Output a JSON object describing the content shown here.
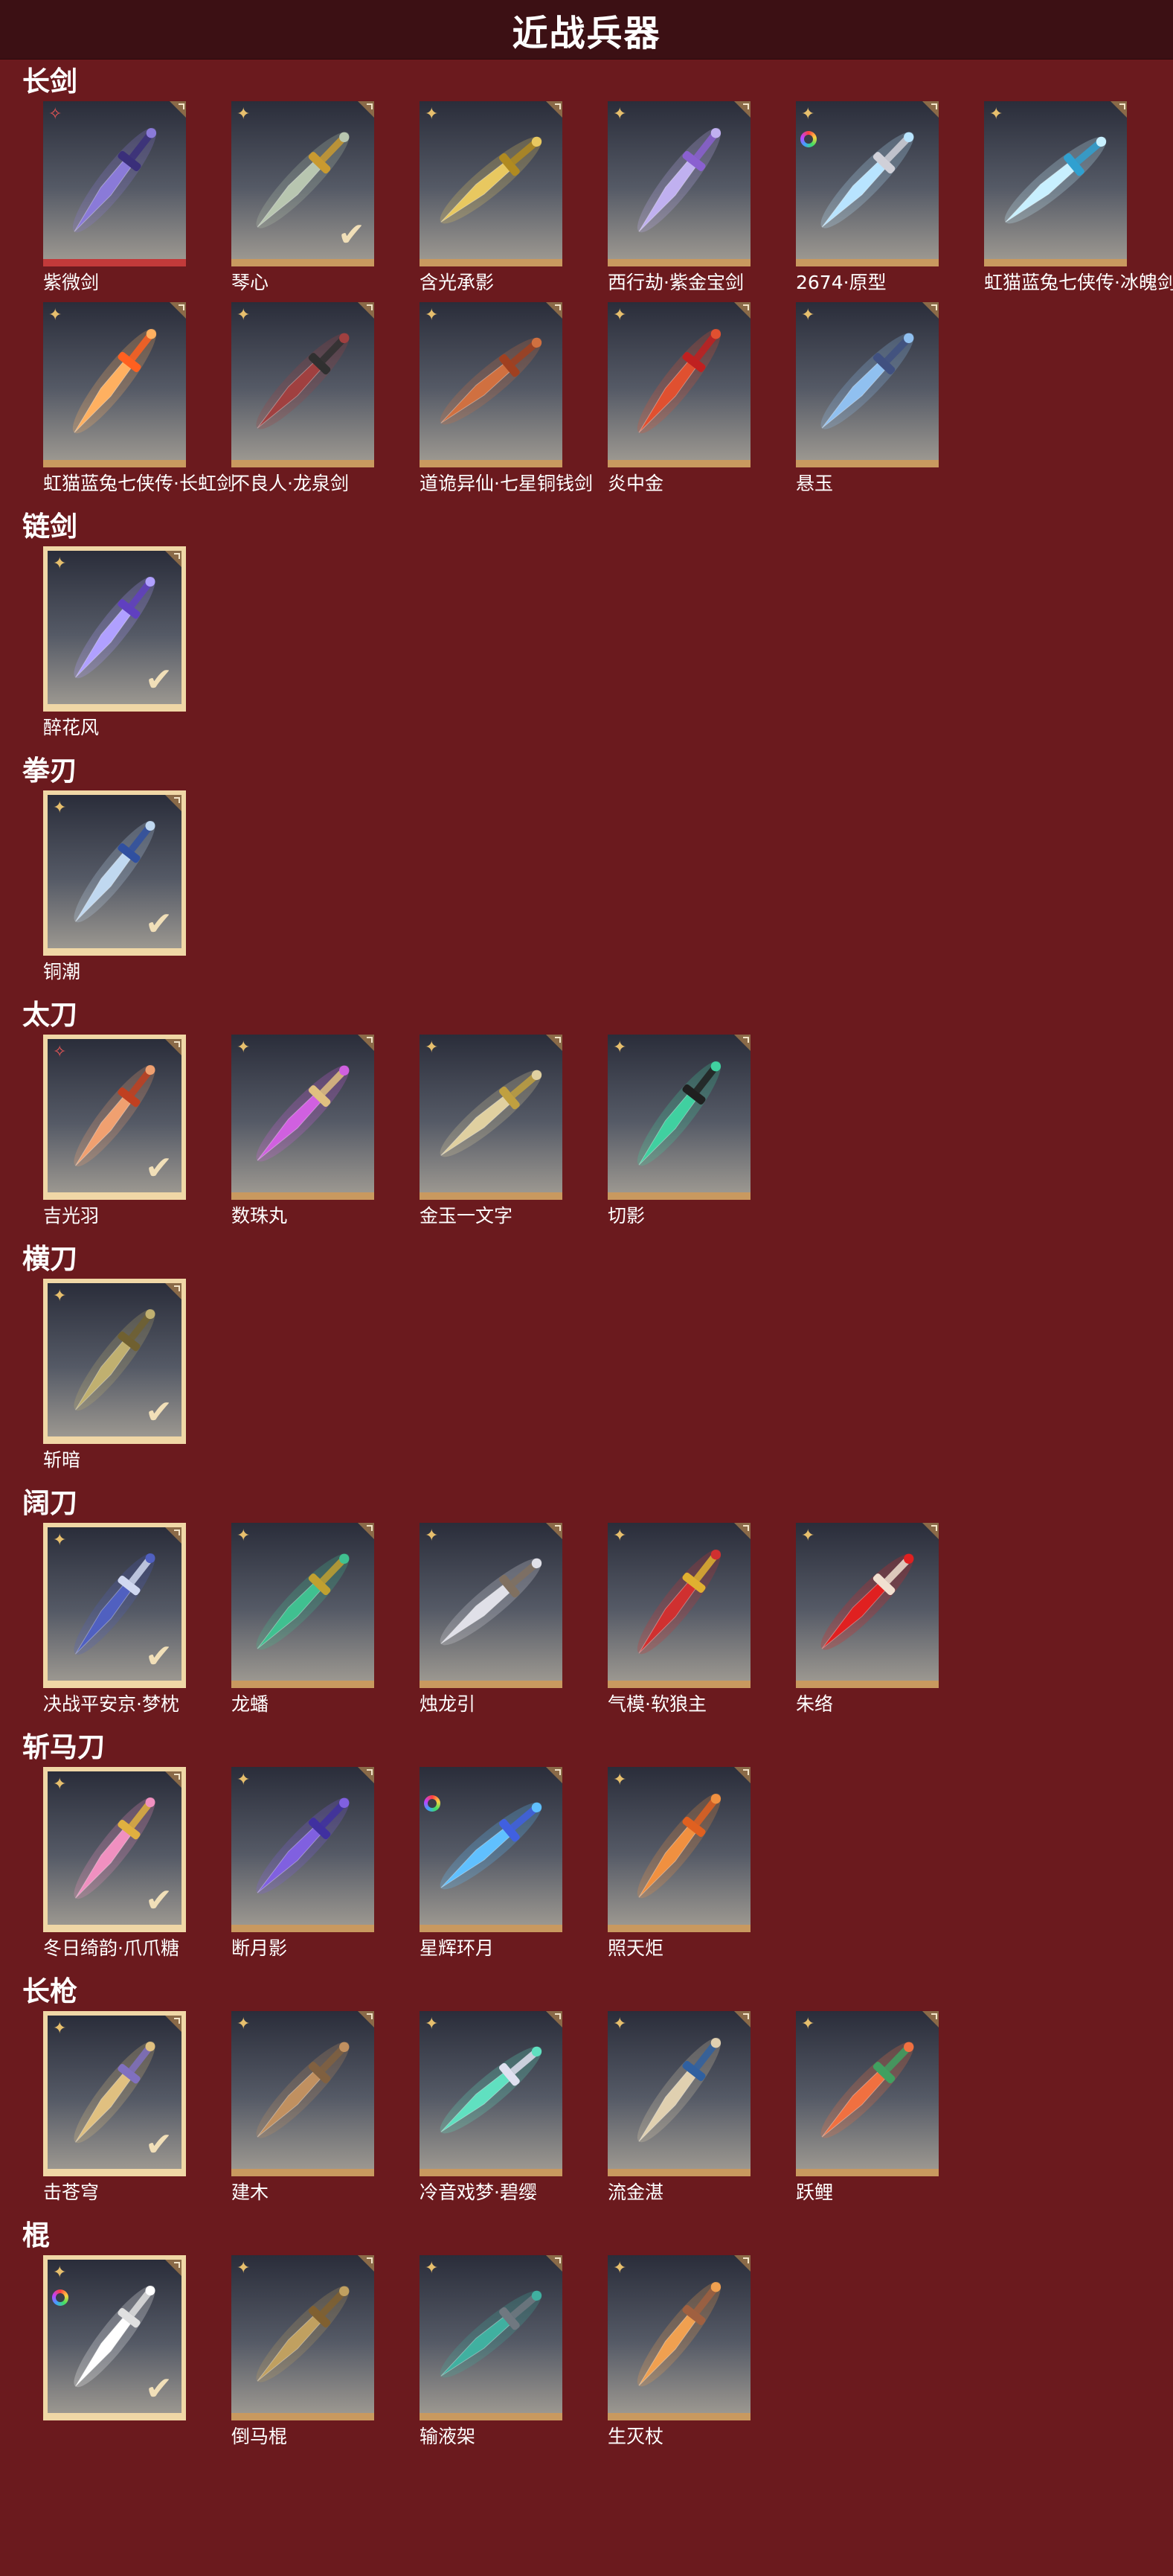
{
  "header": {
    "title": "近战兵器"
  },
  "colors": {
    "background": "#6b1a1e",
    "topbar": "#3c1014",
    "gold": "#c9995f",
    "check": "#f1dfb8"
  },
  "categories": [
    {
      "title": "长剑",
      "items": [
        {
          "name": "紫微剑",
          "badge": "red-star",
          "blade": "#8a7ad8",
          "accent": "#3a2f7a"
        },
        {
          "name": "琴心",
          "badge": "gold-star",
          "blade": "#b8c6b0",
          "accent": "#c99a30",
          "checked": true
        },
        {
          "name": "含光承影",
          "badge": "gold-star",
          "blade": "#e8c860",
          "accent": "#b08a20"
        },
        {
          "name": "西行劫·紫金宝剑",
          "badge": "gold-star",
          "blade": "#c0b0f0",
          "accent": "#8a60d0"
        },
        {
          "name": "2674·原型",
          "badge": "gold-star",
          "extra": "rainbow",
          "blade": "#b8e4ff",
          "accent": "#d0d0d8"
        },
        {
          "name": "虹猫蓝兔七侠传·冰魄剑",
          "badge": "gold-star",
          "blade": "#c8f0ff",
          "accent": "#30a0d0"
        },
        {
          "name": "虹猫蓝兔七侠传·长虹剑",
          "badge": "gold-star",
          "blade": "#ffb060",
          "accent": "#ff6020"
        },
        {
          "name": "不良人·龙泉剑",
          "badge": "gold-star",
          "blade": "#a04040",
          "accent": "#303030"
        },
        {
          "name": "道诡异仙·七星铜钱剑",
          "badge": "gold-star",
          "blade": "#d07040",
          "accent": "#a04020"
        },
        {
          "name": "炎中金",
          "badge": "gold-star",
          "blade": "#e05030",
          "accent": "#c02020"
        },
        {
          "name": "悬玉",
          "badge": "gold-star",
          "blade": "#90c0f0",
          "accent": "#405080"
        }
      ]
    },
    {
      "title": "链剑",
      "items": [
        {
          "name": "醉花风",
          "badge": "gold-star",
          "blade": "#b0a0ff",
          "accent": "#6040c0",
          "selected": true,
          "checked": true
        }
      ]
    },
    {
      "title": "拳刃",
      "items": [
        {
          "name": "铜潮",
          "badge": "gold-star",
          "blade": "#c0d8f0",
          "accent": "#3050a0",
          "selected": true,
          "checked": true
        }
      ]
    },
    {
      "title": "太刀",
      "items": [
        {
          "name": "吉光羽",
          "badge": "red-star",
          "blade": "#f0a070",
          "accent": "#c04020",
          "selected": true,
          "checked": true
        },
        {
          "name": "数珠丸",
          "badge": "gold-star",
          "blade": "#d060e0",
          "accent": "#e0c080"
        },
        {
          "name": "金玉一文字",
          "badge": "gold-star",
          "blade": "#e0d0a0",
          "accent": "#c0a040"
        },
        {
          "name": "切影",
          "badge": "gold-star",
          "blade": "#40d0a0",
          "accent": "#202020"
        }
      ]
    },
    {
      "title": "横刀",
      "items": [
        {
          "name": "斩暗",
          "badge": "gold-star",
          "blade": "#c0b070",
          "accent": "#706030",
          "selected": true,
          "checked": true
        }
      ]
    },
    {
      "title": "阔刀",
      "items": [
        {
          "name": "决战平安京·梦枕",
          "badge": "gold-star",
          "blade": "#5060c0",
          "accent": "#d0d8f0",
          "selected": true,
          "checked": true
        },
        {
          "name": "龙蟠",
          "badge": "gold-star",
          "blade": "#40c090",
          "accent": "#c0a030"
        },
        {
          "name": "烛龙引",
          "badge": "gold-star",
          "blade": "#e0e0e8",
          "accent": "#807060"
        },
        {
          "name": "气模·软狼主",
          "badge": "gold-star",
          "blade": "#d03030",
          "accent": "#e0b030"
        },
        {
          "name": "朱络",
          "badge": "gold-star",
          "blade": "#e02020",
          "accent": "#f0e0d0"
        }
      ]
    },
    {
      "title": "斩马刀",
      "items": [
        {
          "name": "冬日绮韵·爪爪糖",
          "badge": "gold-star",
          "blade": "#f090c0",
          "accent": "#e0b040",
          "selected": true,
          "checked": true
        },
        {
          "name": "断月影",
          "badge": "gold-star",
          "blade": "#8060e0",
          "accent": "#4030a0"
        },
        {
          "name": "星辉环月",
          "badge": "rainbow-only",
          "blade": "#60c0ff",
          "accent": "#4060e0"
        },
        {
          "name": "照天炬",
          "badge": "gold-star",
          "blade": "#f09040",
          "accent": "#e06020"
        }
      ]
    },
    {
      "title": "长枪",
      "items": [
        {
          "name": "击苍穹",
          "badge": "gold-star",
          "blade": "#e0c080",
          "accent": "#8070c0",
          "selected": true,
          "checked": true
        },
        {
          "name": "建木",
          "badge": "gold-star",
          "blade": "#c09060",
          "accent": "#806040"
        },
        {
          "name": "冷音戏梦·碧缨",
          "badge": "gold-star",
          "blade": "#60e0c0",
          "accent": "#e0e0f0"
        },
        {
          "name": "流金湛",
          "badge": "gold-star",
          "blade": "#e0d0b0",
          "accent": "#3060a0"
        },
        {
          "name": "跃鲤",
          "badge": "gold-star",
          "blade": "#f07040",
          "accent": "#40a060"
        }
      ]
    },
    {
      "title": "棍",
      "items": [
        {
          "name": "",
          "badge": "gold-star",
          "extra": "rainbow",
          "blade": "#ffffff",
          "accent": "#e0e0e0",
          "selected": true,
          "checked": true
        },
        {
          "name": "倒马棍",
          "badge": "gold-star",
          "blade": "#c0a060",
          "accent": "#806030"
        },
        {
          "name": "输液架",
          "badge": "gold-star",
          "blade": "#40b0a0",
          "accent": "#707880"
        },
        {
          "name": "生灭杖",
          "badge": "gold-star",
          "blade": "#f0a050",
          "accent": "#a06040"
        }
      ]
    }
  ]
}
